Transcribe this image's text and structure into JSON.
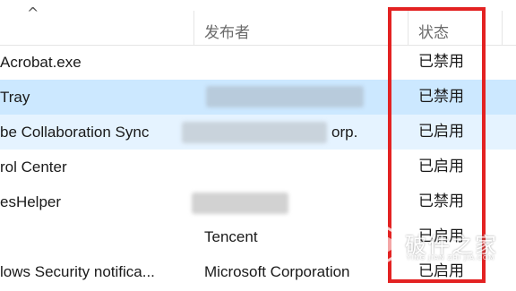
{
  "header": {
    "sort_indicator": "^",
    "columns": {
      "publisher": "发布者",
      "status": "状态"
    }
  },
  "rows": [
    {
      "name": "Acrobat.exe",
      "publisher": "",
      "status": "已禁用"
    },
    {
      "name": "Tray",
      "publisher": "",
      "status": "已禁用"
    },
    {
      "name": "be Collaboration Sync",
      "publisher": "orp.",
      "status": "已启用"
    },
    {
      "name": "rol Center",
      "publisher": "",
      "status": "已启用"
    },
    {
      "name": "esHelper",
      "publisher": "",
      "status": "已禁用"
    },
    {
      "name": "",
      "publisher": "Tencent",
      "status": "已启用"
    },
    {
      "name": "lows Security notifica...",
      "publisher": "Microsoft Corporation",
      "status": "已启用"
    }
  ],
  "watermark": {
    "text": "破件之家",
    "sub": "YING JIAN ZHI JIA.COM"
  },
  "colors": {
    "selected_row": "#cce8ff",
    "hover_row": "#e5f3ff",
    "highlight_box": "#e32222"
  }
}
